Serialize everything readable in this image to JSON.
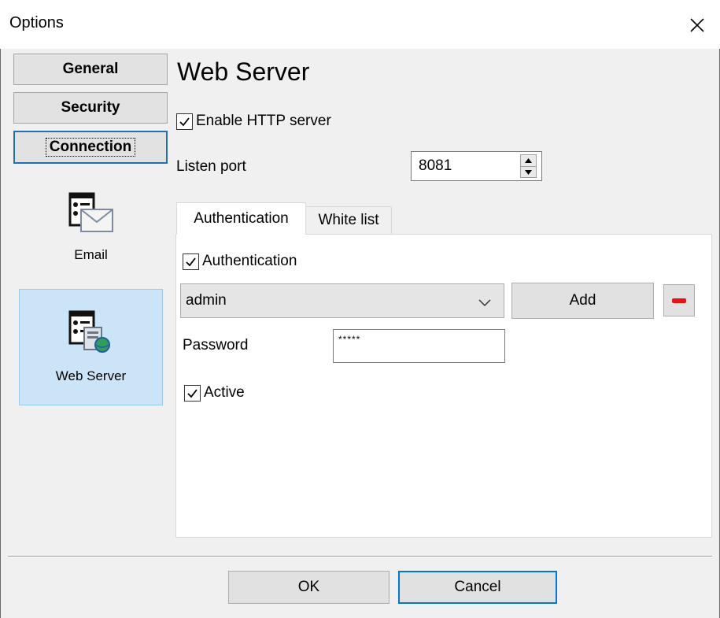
{
  "window": {
    "title": "Options",
    "close_icon": "close-icon"
  },
  "sidebar": {
    "categories": [
      {
        "label": "General",
        "active": false
      },
      {
        "label": "Security",
        "active": false
      },
      {
        "label": "Connection",
        "active": true
      }
    ],
    "items": [
      {
        "label": "Email",
        "icon": "email-settings-icon",
        "selected": false
      },
      {
        "label": "Web Server",
        "icon": "web-server-icon",
        "selected": true
      }
    ]
  },
  "main": {
    "heading": "Web Server",
    "enable_http": {
      "label": "Enable HTTP server",
      "checked": true
    },
    "listen_port": {
      "label": "Listen port",
      "value": "8081"
    },
    "tabs": [
      {
        "label": "Authentication",
        "active": true
      },
      {
        "label": "White list",
        "active": false
      }
    ],
    "auth": {
      "checkbox": {
        "label": "Authentication",
        "checked": true
      },
      "user": {
        "selected": "admin"
      },
      "add_label": "Add",
      "password": {
        "label": "Password",
        "value": "*****"
      },
      "active": {
        "label": "Active",
        "checked": true
      }
    }
  },
  "footer": {
    "ok_label": "OK",
    "cancel_label": "Cancel"
  },
  "colors": {
    "accent": "#0078d7",
    "selected_bg": "#cce4f7",
    "remove": "#e81313"
  }
}
